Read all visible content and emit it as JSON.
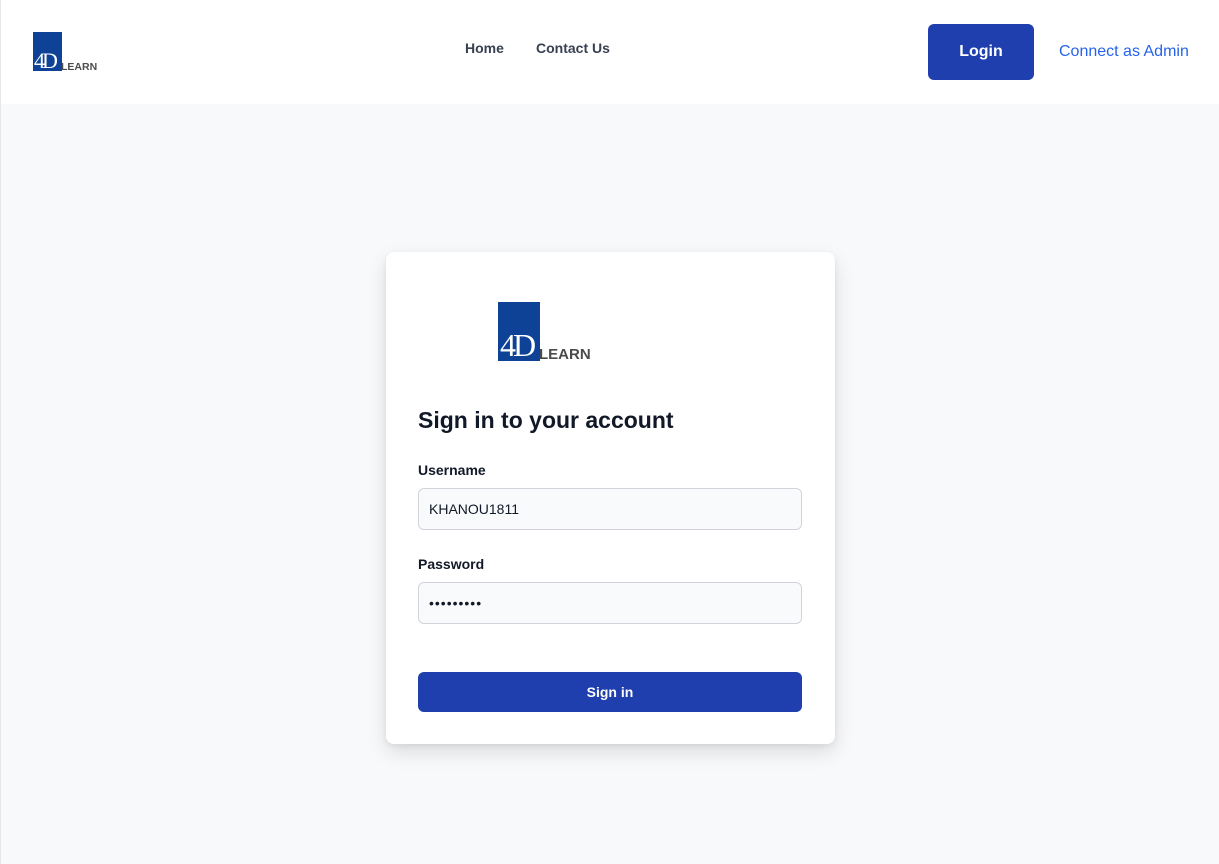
{
  "brand": {
    "mark_text": "4D",
    "word": "LEARN",
    "color": "#0d4296"
  },
  "header": {
    "nav": [
      {
        "label": "Home"
      },
      {
        "label": "Contact Us"
      }
    ],
    "login_label": "Login",
    "admin_link": "Connect as Admin"
  },
  "login_form": {
    "title": "Sign in to your account",
    "username_label": "Username",
    "username_value": "KHANOU1811",
    "password_label": "Password",
    "password_value": "123456789",
    "submit_label": "Sign in"
  },
  "colors": {
    "primary": "#1e3fad",
    "link": "#2563eb",
    "background": "#f8f9fb"
  }
}
